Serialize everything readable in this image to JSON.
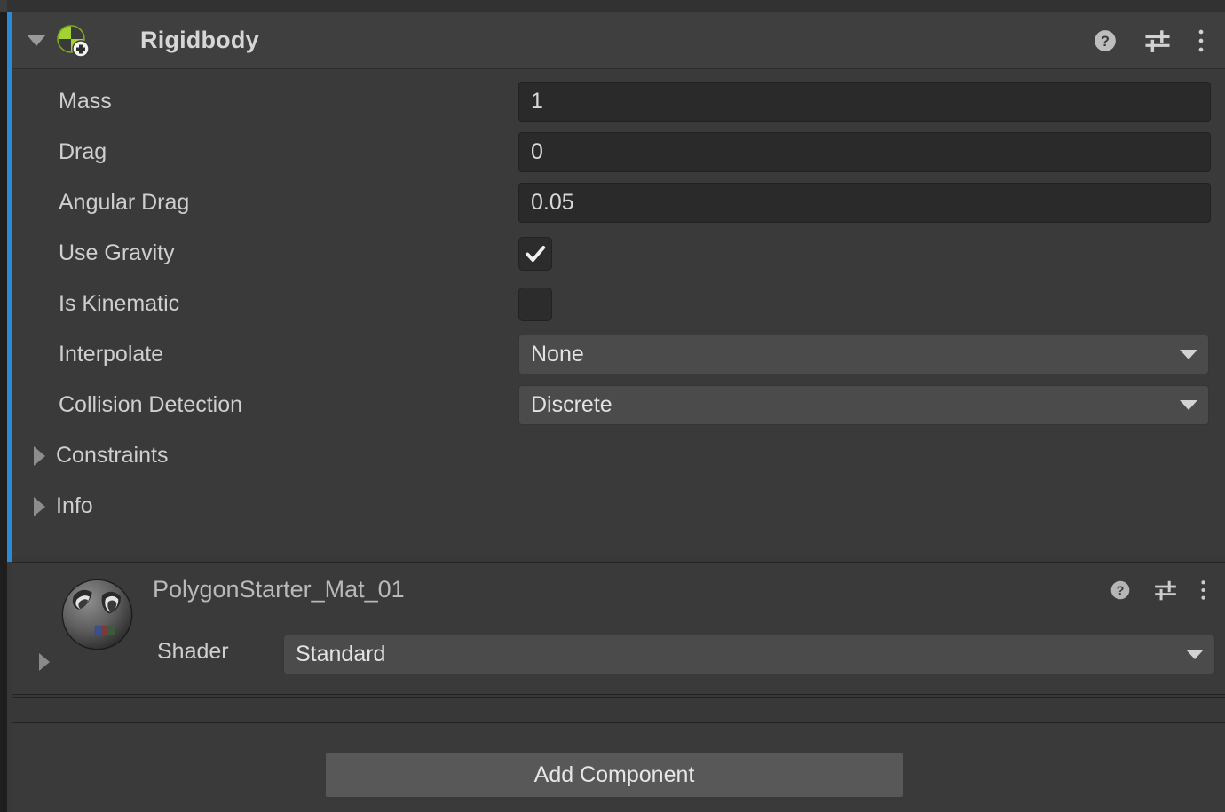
{
  "component": {
    "title": "Rigidbody",
    "icon": "rigidbody-icon",
    "expanded": true,
    "header_icons": [
      {
        "name": "help-icon",
        "label": "?"
      },
      {
        "name": "preset-icon",
        "label": "Preset"
      },
      {
        "name": "more-menu-icon",
        "label": "More"
      }
    ],
    "properties": [
      {
        "label": "Mass",
        "type": "number",
        "value": "1"
      },
      {
        "label": "Drag",
        "type": "number",
        "value": "0"
      },
      {
        "label": "Angular Drag",
        "type": "number",
        "value": "0.05"
      },
      {
        "label": "Use Gravity",
        "type": "checkbox",
        "value": true
      },
      {
        "label": "Is Kinematic",
        "type": "checkbox",
        "value": false
      },
      {
        "label": "Interpolate",
        "type": "dropdown",
        "value": "None"
      },
      {
        "label": "Collision Detection",
        "type": "dropdown",
        "value": "Discrete"
      }
    ],
    "foldouts": [
      {
        "label": "Constraints",
        "expanded": false
      },
      {
        "label": "Info",
        "expanded": false
      }
    ]
  },
  "material": {
    "name": "PolygonStarter_Mat_01",
    "shader_label": "Shader",
    "shader_value": "Standard",
    "header_icons": [
      {
        "name": "help-icon",
        "label": "?"
      },
      {
        "name": "preset-icon",
        "label": "Preset"
      },
      {
        "name": "more-menu-icon",
        "label": "More"
      }
    ]
  },
  "footer": {
    "add_component_label": "Add Component"
  },
  "colors": {
    "selection_accent": "#2b8ad6",
    "panel_background": "#3a3a3a",
    "header_background": "#3f3f3f",
    "field_background": "#2a2a2a",
    "dropdown_background": "#4b4b4b",
    "button_background": "#585858",
    "text_primary": "#cfcfcf",
    "rigidbody_icon_green": "#a4d233"
  }
}
